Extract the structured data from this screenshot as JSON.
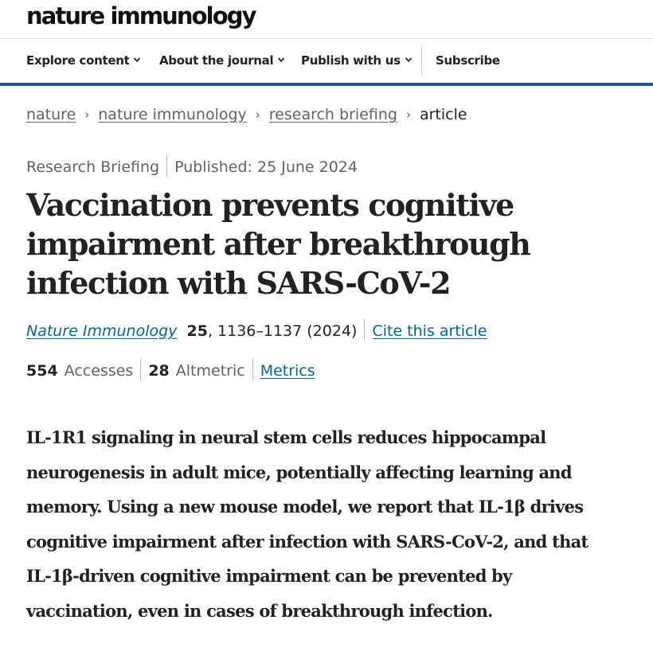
{
  "masthead": {
    "logo_text": "nature immunology"
  },
  "nav": {
    "items": [
      {
        "label": "Explore content",
        "has_dropdown": true
      },
      {
        "label": "About the journal",
        "has_dropdown": true
      },
      {
        "label": "Publish with us",
        "has_dropdown": true
      },
      {
        "label": "Subscribe",
        "has_dropdown": false
      }
    ],
    "accent_color": "#1f4f96"
  },
  "breadcrumb": {
    "items": [
      {
        "label": "nature",
        "link": true
      },
      {
        "label": "nature immunology",
        "link": true
      },
      {
        "label": "research briefing",
        "link": true
      },
      {
        "label": "article",
        "link": false
      }
    ],
    "separator": "›"
  },
  "article": {
    "type": "Research Briefing",
    "published": "Published: 25 June 2024",
    "title_lines": [
      "Vaccination prevents cognitive",
      "impairment after breakthrough",
      "infection with SARS-CoV-2"
    ],
    "citation": {
      "journal": "Nature Immunology",
      "volume": "25",
      "pages_year": ", 1136–1137 (2024)",
      "cite_label": "Cite this article"
    },
    "metrics": {
      "accesses_count": "554",
      "accesses_label": "Accesses",
      "altmetric_count": "28",
      "altmetric_label": "Altmetric",
      "metrics_link": "Metrics"
    },
    "standfirst_lines": [
      "IL-1R1 signaling in neural stem cells reduces hippocampal",
      "neurogenesis in adult mice, potentially affecting learning and",
      "memory. Using a new mouse model, we report that IL-1β drives",
      "cognitive impairment after infection with SARS-CoV-2, and that",
      "IL-1β-driven cognitive impairment can be prevented by",
      "vaccination, even in cases of breakthrough infection."
    ]
  },
  "colors": {
    "link": "#006699",
    "muted_text": "#626262",
    "body_text": "#222222"
  }
}
